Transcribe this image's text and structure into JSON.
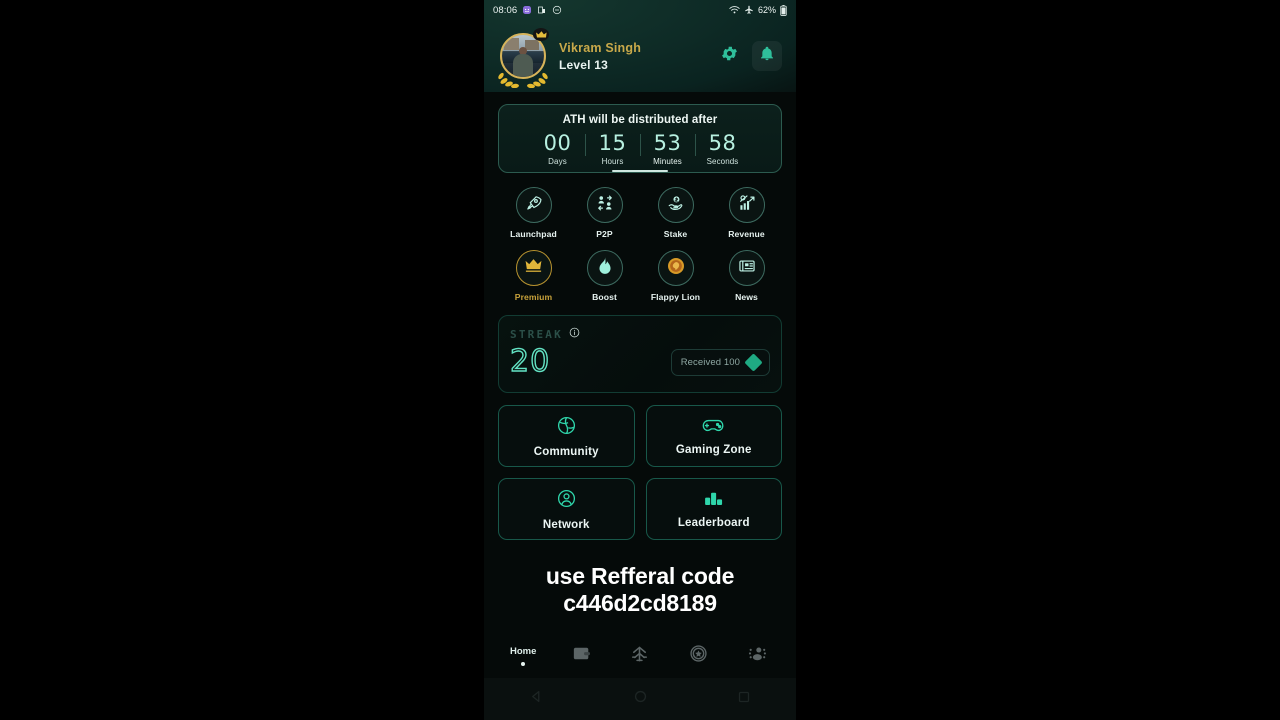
{
  "status_bar": {
    "time": "08:06",
    "battery_percent": "62%",
    "icons": [
      "emoji-icon",
      "screenshot-icon",
      "dnd-icon",
      "wifi-icon",
      "airplane-icon",
      "battery-icon"
    ]
  },
  "header": {
    "user_name": "Vikram Singh",
    "level": "Level 13",
    "avatar_name": "user-avatar",
    "settings_icon": "gear-icon",
    "notification_icon": "bell-icon",
    "name_color": "#c9a94a",
    "accent": "#2fbf9b"
  },
  "countdown": {
    "title": "ATH will be distributed after",
    "units": [
      {
        "value": "00",
        "label": "Days",
        "active": false
      },
      {
        "value": "15",
        "label": "Hours",
        "active": false
      },
      {
        "value": "53",
        "label": "Minutes",
        "active": true
      },
      {
        "value": "58",
        "label": "Seconds",
        "active": false
      }
    ]
  },
  "quick_actions": [
    {
      "label": "Launchpad",
      "icon": "rocket-icon",
      "highlight": false
    },
    {
      "label": "P2P",
      "icon": "people-exchange-icon",
      "highlight": false
    },
    {
      "label": "Stake",
      "icon": "hand-coin-icon",
      "highlight": false
    },
    {
      "label": "Revenue",
      "icon": "chart-growth-icon",
      "highlight": false
    },
    {
      "label": "Premium",
      "icon": "crown-icon",
      "highlight": true
    },
    {
      "label": "Boost",
      "icon": "flame-icon",
      "highlight": false
    },
    {
      "label": "Flappy Lion",
      "icon": "lion-coin-icon",
      "highlight": false
    },
    {
      "label": "News",
      "icon": "newspaper-icon",
      "highlight": false
    }
  ],
  "streak": {
    "title": "STREAK",
    "info_icon": "info-icon",
    "count": "20",
    "reward_text": "Received 100",
    "reward_icon": "gem-icon"
  },
  "feature_cards": [
    {
      "label": "Community",
      "icon": "globe-icon"
    },
    {
      "label": "Gaming Zone",
      "icon": "gamepad-icon"
    },
    {
      "label": "Network",
      "icon": "user-circle-icon"
    },
    {
      "label": "Leaderboard",
      "icon": "bar-chart-icon"
    }
  ],
  "referral_overlay": {
    "line1": "use Refferal code",
    "line2": "c446d2cd8189"
  },
  "bottom_nav": [
    {
      "label": "Home",
      "icon": "home-label",
      "active": true
    },
    {
      "label": "",
      "icon": "wallet-icon",
      "active": false
    },
    {
      "label": "",
      "icon": "tree-network-icon",
      "active": false
    },
    {
      "label": "",
      "icon": "shield-star-icon",
      "active": false
    },
    {
      "label": "",
      "icon": "group-icon",
      "active": false
    }
  ],
  "android_nav": [
    {
      "icon": "back-triangle-icon"
    },
    {
      "icon": "home-circle-icon"
    },
    {
      "icon": "recents-square-icon"
    }
  ]
}
